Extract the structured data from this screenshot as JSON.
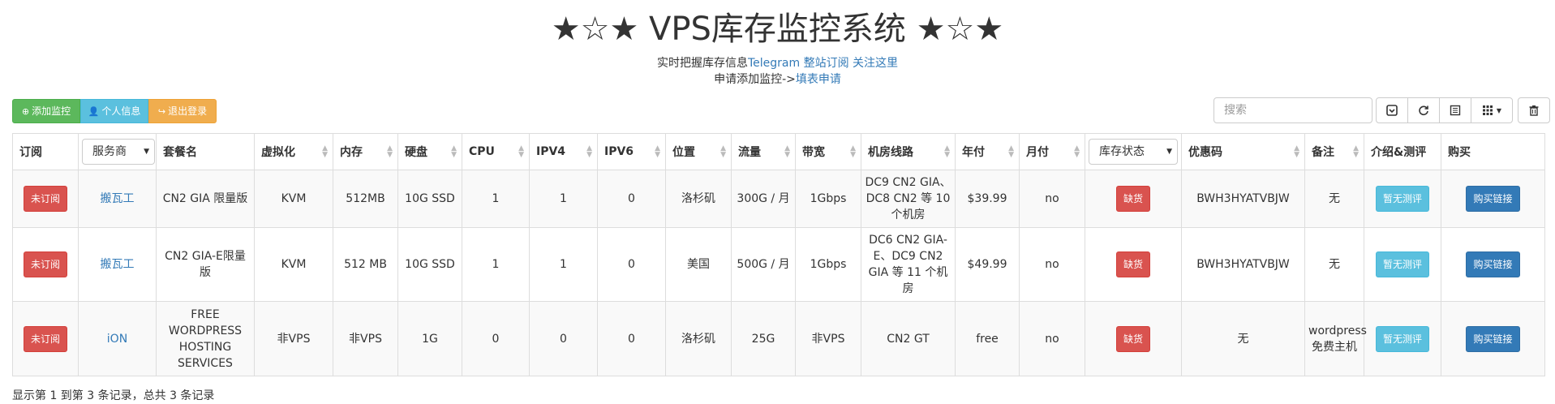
{
  "page": {
    "title": "★☆★ VPS库存监控系统 ★☆★",
    "subtitle": {
      "prefix": "实时把握库存信息",
      "telegram": "Telegram",
      "subscribe": "整站订阅",
      "follow": "关注这里"
    },
    "apply": {
      "prefix": "申请添加监控->",
      "link": "填表申请"
    }
  },
  "toolbar": {
    "add": "添加监控",
    "profile": "个人信息",
    "logout": "退出登录",
    "search_placeholder": "搜索"
  },
  "table": {
    "columns": [
      "订阅",
      "服务商",
      "套餐名",
      "虚拟化",
      "内存",
      "硬盘",
      "CPU",
      "IPV4",
      "IPV6",
      "位置",
      "流量",
      "带宽",
      "机房线路",
      "年付",
      "月付",
      "库存状态",
      "优惠码",
      "备注",
      "介绍&测评",
      "购买"
    ],
    "rows": [
      {
        "subscribe": "未订阅",
        "provider": "搬瓦工",
        "plan": "CN2 GIA 限量版",
        "virt": "KVM",
        "ram": "512MB",
        "disk": "10G SSD",
        "cpu": "1",
        "ipv4": "1",
        "ipv6": "0",
        "location": "洛杉矶",
        "traffic": "300G / 月",
        "bandwidth": "1Gbps",
        "route": "DC9 CN2 GIA、DC8 CN2 等 10 个机房",
        "yearly": "$39.99",
        "monthly": "no",
        "stock": "缺货",
        "coupon": "BWH3HYATVBJW",
        "note": "无",
        "review": "暂无测评",
        "buy": "购买链接"
      },
      {
        "subscribe": "未订阅",
        "provider": "搬瓦工",
        "plan": "CN2 GIA-E限量版",
        "virt": "KVM",
        "ram": "512 MB",
        "disk": "10G SSD",
        "cpu": "1",
        "ipv4": "1",
        "ipv6": "0",
        "location": "美国",
        "traffic": "500G / 月",
        "bandwidth": "1Gbps",
        "route": "DC6 CN2 GIA-E、DC9 CN2 GIA 等 11 个机房",
        "yearly": "$49.99",
        "monthly": "no",
        "stock": "缺货",
        "coupon": "BWH3HYATVBJW",
        "note": "无",
        "review": "暂无测评",
        "buy": "购买链接"
      },
      {
        "subscribe": "未订阅",
        "provider": "iON",
        "plan": "FREE WORDPRESS HOSTING SERVICES",
        "virt": "非VPS",
        "ram": "非VPS",
        "disk": "1G",
        "cpu": "0",
        "ipv4": "0",
        "ipv6": "0",
        "location": "洛杉矶",
        "traffic": "25G",
        "bandwidth": "非VPS",
        "route": "CN2 GT",
        "yearly": "free",
        "monthly": "no",
        "stock": "缺货",
        "coupon": "无",
        "note": "wordpress免费主机",
        "review": "暂无测评",
        "buy": "购买链接"
      }
    ]
  },
  "footer": "显示第 1 到第 3 条记录，总共 3 条记录",
  "colors": {
    "green": "#5cb85c",
    "cyan": "#5bc0de",
    "orange": "#f0ad4e",
    "danger": "#d9534f",
    "primary": "#337ab7",
    "link": "#337ab7"
  },
  "icons": [
    "plus-circle-icon",
    "user-icon",
    "sign-out-icon",
    "collapse-icon",
    "refresh-icon",
    "toggle-view-icon",
    "columns-icon",
    "trash-icon"
  ]
}
